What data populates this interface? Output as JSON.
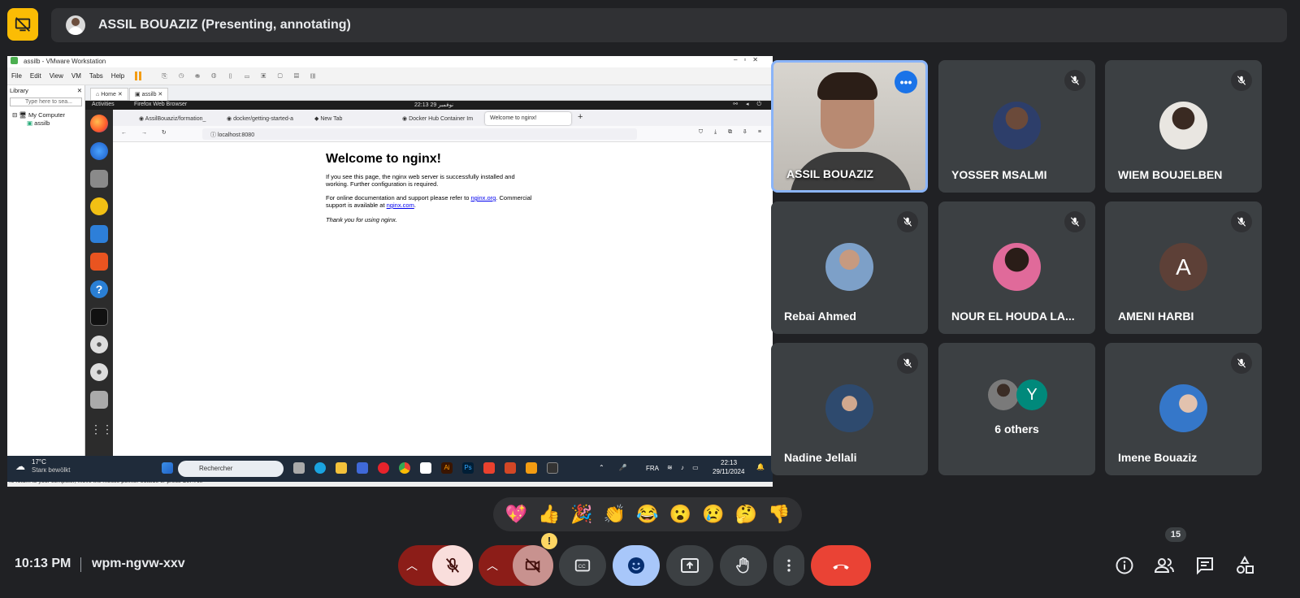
{
  "presenter_bar": {
    "title": "ASSIL BOUAZIZ (Presenting, annotating)"
  },
  "vm": {
    "window_title": "assilb - VMware Workstation",
    "menu": [
      "File",
      "Edit",
      "View",
      "VM",
      "Tabs",
      "Help"
    ],
    "library_label": "Library",
    "library_search_placeholder": "Type here to sea...",
    "tree_root": "My Computer",
    "tree_child": "assilb",
    "tabs": [
      "Home",
      "assilb"
    ],
    "status": "To return to your computer, move the mouse pointer outside or press Ctrl+Alt."
  },
  "ubuntu": {
    "activities": "Activities",
    "app": "Firefox Web Browser",
    "clock": "22:13  29 نوفمبر"
  },
  "firefox": {
    "tabs": [
      "AssilBouaziz/formation_",
      "docker/getting-started-a",
      "New Tab",
      "Docker Hub Container Im",
      "Welcome to nginx!"
    ],
    "url": "localhost:8080"
  },
  "nginx": {
    "heading": "Welcome to nginx!",
    "p1": "If you see this page, the nginx web server is successfully installed and working. Further configuration is required.",
    "p2_prefix": "For online documentation and support please refer to ",
    "p2_link": "nginx.org",
    "p2_mid": ". Commercial support is available at ",
    "p2_link2": "nginx.com",
    "p2_suffix": ".",
    "p3": "Thank you for using nginx."
  },
  "windows_taskbar": {
    "weather_temp": "17°C",
    "weather_desc": "Starк bewölkt",
    "search_placeholder": "Rechercher",
    "lang": "FRA",
    "time": "22:13",
    "date": "29/11/2024"
  },
  "participants": [
    {
      "name": "ASSIL BOUAZIZ",
      "active": true
    },
    {
      "name": "YOSSER MSALMI"
    },
    {
      "name": "WIEM BOUJELBEN"
    },
    {
      "name": "Rebai Ahmed"
    },
    {
      "name": "NOUR EL HOUDA LA..."
    },
    {
      "name": "AMENI HARBI",
      "initial": "A"
    },
    {
      "name": "Nadine Jellali"
    },
    {
      "name": "6 others",
      "initial": "Y"
    },
    {
      "name": "Imene Bouaziz"
    }
  ],
  "reactions": [
    "💖",
    "👍",
    "🎉",
    "👏",
    "😂",
    "😮",
    "😢",
    "🤔",
    "👎"
  ],
  "meeting": {
    "time": "10:13 PM",
    "code": "wpm-ngvw-xxv",
    "people_count": "15",
    "camera_warning": "!"
  },
  "colors": {
    "background": "#202124",
    "tile": "#3c4043",
    "accent_yellow": "#fbbc04",
    "end_call": "#ea4335",
    "active_border": "#8ab4f8",
    "muted_red": "#8c1d18"
  }
}
